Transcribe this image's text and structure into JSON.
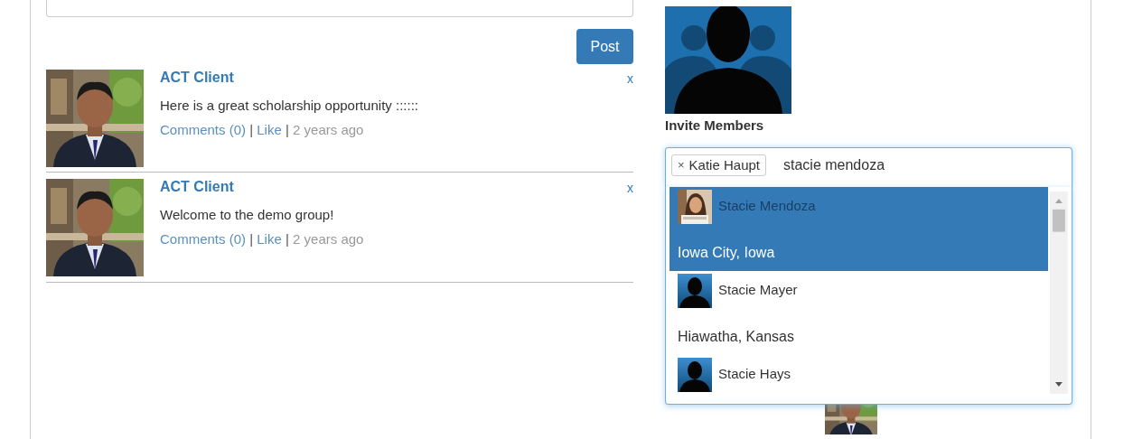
{
  "composer": {
    "button": "Post"
  },
  "posts": [
    {
      "author": "ACT Client",
      "text": "Here is a great scholarship opportunity ::::::",
      "comments": "Comments (0)",
      "separator": "|",
      "like": "Like",
      "separator_2": "|",
      "time": "2 years ago",
      "close": "x"
    },
    {
      "author": "ACT Client",
      "text": "Welcome to the demo group!",
      "comments": "Comments (0)",
      "separator": "|",
      "like": "Like",
      "separator_2": "|",
      "time": "2 years ago",
      "close": "x"
    }
  ],
  "group": {
    "invite_label": "Invite Members",
    "tokens": [
      {
        "label": "Katie Haupt",
        "remove": "×"
      }
    ],
    "query": "stacie mendoza",
    "suggestions": [
      {
        "name": "Stacie Mendoza",
        "location": "Iowa City, Iowa",
        "selected": true
      },
      {
        "name": "Stacie Mayer",
        "location": "Hiawatha, Kansas",
        "selected": false,
        "kind": "silhouette"
      },
      {
        "name": "Stacie Hays",
        "selected": false,
        "kind": "silhouette"
      }
    ]
  }
}
